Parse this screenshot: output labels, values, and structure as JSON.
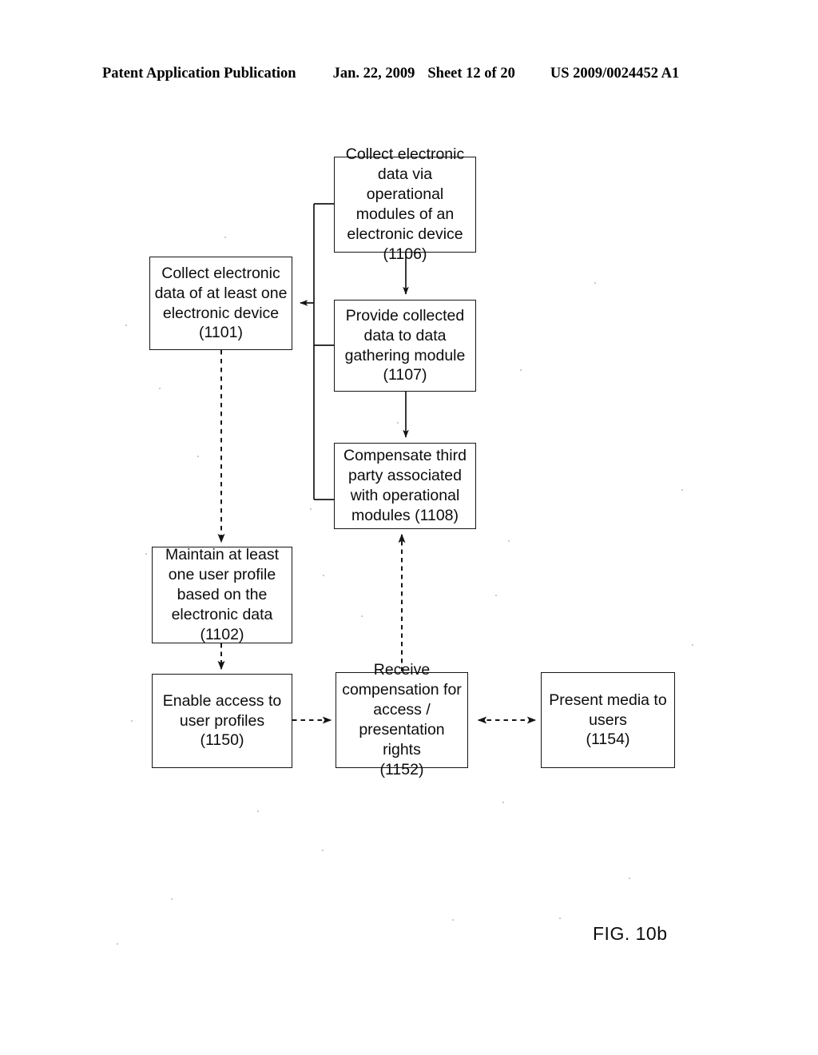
{
  "header": {
    "publication": "Patent Application Publication",
    "date": "Jan. 22, 2009",
    "sheet": "Sheet 12 of 20",
    "number": "US 2009/0024452 A1"
  },
  "figure": {
    "caption": "FIG. 10b"
  },
  "flowchart": {
    "boxes": [
      {
        "id": "1106",
        "text": "Collect electronic\ndata via operational\nmodules of an\nelectronic device\n(1106)"
      },
      {
        "id": "1101",
        "text": "Collect electronic\ndata of at least one\nelectronic device\n(1101)"
      },
      {
        "id": "1107",
        "text": "Provide collected\ndata to data\ngathering module\n(1107)"
      },
      {
        "id": "1108",
        "text": "Compensate third\nparty associated\nwith operational\nmodules (1108)"
      },
      {
        "id": "1102",
        "text": "Maintain at least\none user profile\nbased on the\nelectronic data\n(1102)"
      },
      {
        "id": "1150",
        "text": "Enable access to\nuser profiles\n(1150)"
      },
      {
        "id": "1152",
        "text": "Receive\ncompensation for\naccess /\npresentation rights\n(1152)"
      },
      {
        "id": "1154",
        "text": "Present media to\nusers\n(1154)"
      }
    ],
    "connectors": [
      {
        "from": "1106",
        "to": "1107",
        "style": "solid",
        "direction": "down"
      },
      {
        "from": "1107",
        "to": "1108",
        "style": "solid",
        "direction": "down"
      },
      {
        "from": "bus-1106-1107-1108",
        "to": "1101",
        "style": "solid",
        "direction": "left"
      },
      {
        "from": "1101",
        "to": "1102",
        "style": "dashed",
        "direction": "down"
      },
      {
        "from": "1102",
        "to": "1150",
        "style": "dashed",
        "direction": "down"
      },
      {
        "from": "1150",
        "to": "1152",
        "style": "dashed",
        "direction": "right"
      },
      {
        "from": "1154",
        "to": "1152",
        "style": "dashed",
        "direction": "bidirectional"
      },
      {
        "from": "1152",
        "to": "1108",
        "style": "dashed",
        "direction": "up"
      }
    ]
  },
  "colors": {
    "ink": "#0c0c0c",
    "line": "#161616",
    "page": "#ffffff"
  }
}
